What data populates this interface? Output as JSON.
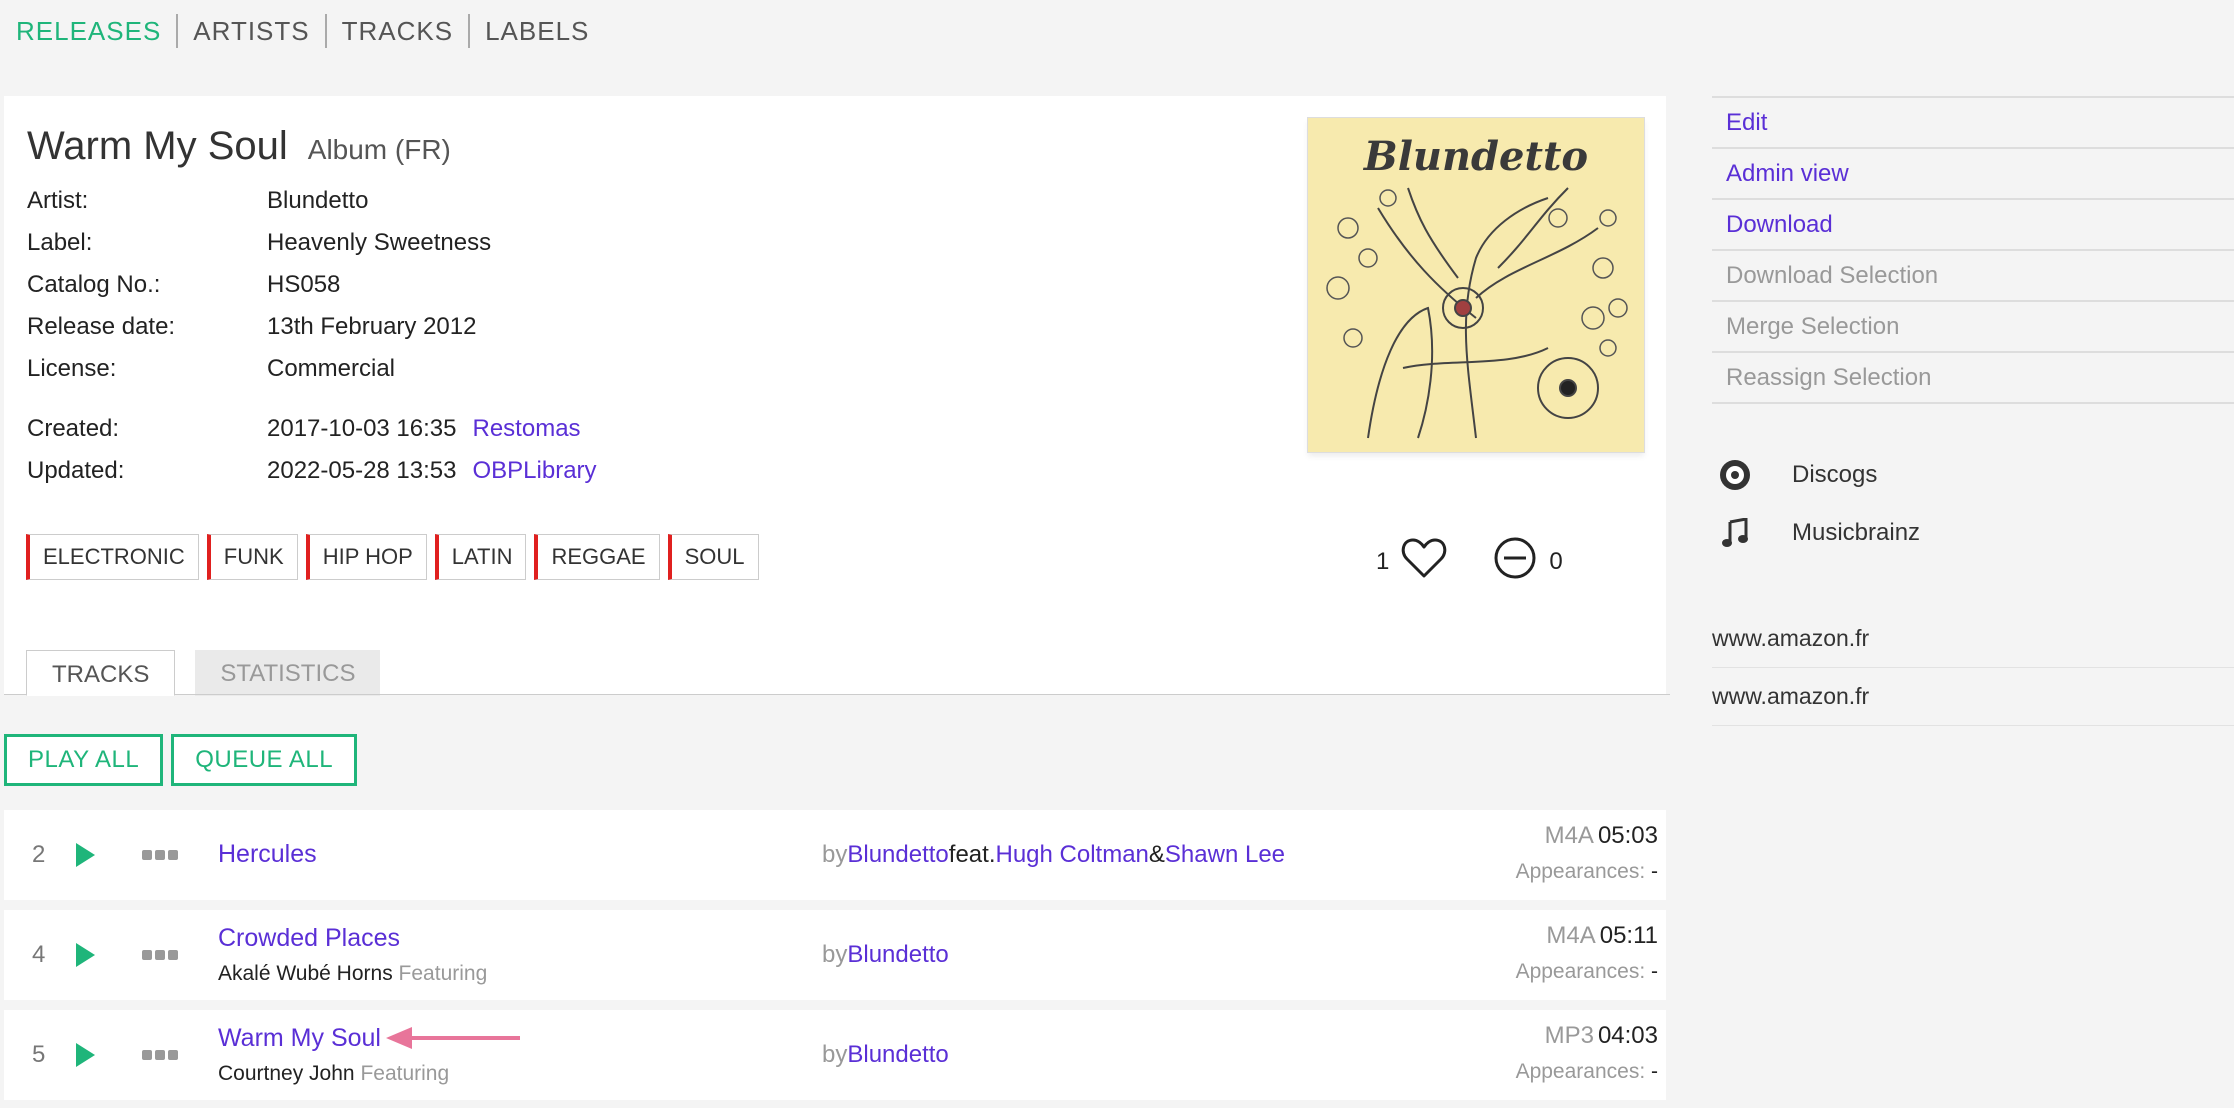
{
  "nav": {
    "items": [
      "RELEASES",
      "ARTISTS",
      "TRACKS",
      "LABELS"
    ],
    "active": "RELEASES"
  },
  "release": {
    "title": "Warm My Soul",
    "subtitle": "Album (FR)",
    "fields": {
      "artist_label": "Artist:",
      "artist": "Blundetto",
      "label_label": "Label:",
      "label": "Heavenly Sweetness",
      "catalog_label": "Catalog No.:",
      "catalog": "HS058",
      "release_date_label": "Release date:",
      "release_date": "13th February 2012",
      "license_label": "License:",
      "license": "Commercial",
      "created_label": "Created:",
      "created": "2017-10-03 16:35",
      "created_by": "Restomas",
      "updated_label": "Updated:",
      "updated": "2022-05-28 13:53",
      "updated_by": "OBPLibrary"
    },
    "cover_text": "Blundetto",
    "genres": [
      "ELECTRONIC",
      "FUNK",
      "HIP HOP",
      "LATIN",
      "REGGAE",
      "SOUL"
    ],
    "likes": "1",
    "dislikes": "0"
  },
  "tabs": [
    "TRACKS",
    "STATISTICS"
  ],
  "actions": {
    "play_all": "PLAY ALL",
    "queue_all": "QUEUE ALL"
  },
  "tracks": [
    {
      "number": "2",
      "title": "Hercules",
      "featuring": "",
      "featuring_role": "",
      "by": "by",
      "artist": "Blundetto",
      "feat_word": "feat.",
      "feat1": "Hugh Coltman",
      "amp": "&",
      "feat2": "Shawn Lee",
      "format": "M4A",
      "duration": "05:03",
      "appearances_label": "Appearances:",
      "appearances": "-"
    },
    {
      "number": "4",
      "title": "Crowded Places",
      "featuring": "Akalé Wubé Horns",
      "featuring_role": "Featuring",
      "by": "by",
      "artist": "Blundetto",
      "format": "M4A",
      "duration": "05:11",
      "appearances_label": "Appearances:",
      "appearances": "-"
    },
    {
      "number": "5",
      "title": "Warm My Soul",
      "featuring": "Courtney John",
      "featuring_role": "Featuring",
      "by": "by",
      "artist": "Blundetto",
      "format": "MP3",
      "duration": "04:03",
      "appearances_label": "Appearances:",
      "appearances": "-"
    }
  ],
  "sidebar": {
    "actions": [
      "Edit",
      "Admin view",
      "Download",
      "Download Selection",
      "Merge Selection",
      "Reassign Selection"
    ],
    "external": [
      "Discogs",
      "Musicbrainz"
    ],
    "links": [
      "www.amazon.fr",
      "www.amazon.fr"
    ]
  },
  "colors": {
    "accent_green": "#1fb57a",
    "link_purple": "#5a2fd6",
    "genre_red": "#e0201f",
    "arrow_pink": "#e8759a"
  }
}
